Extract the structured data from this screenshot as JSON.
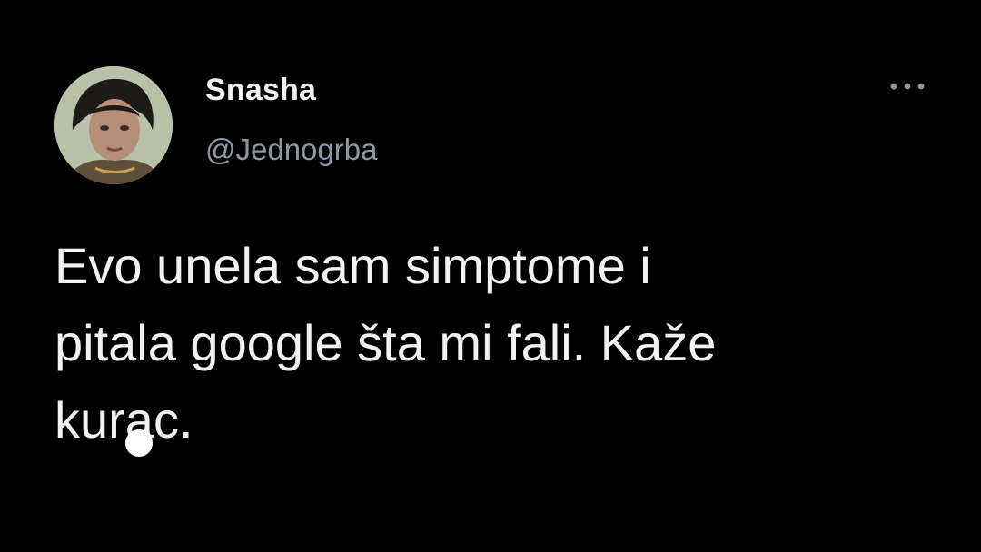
{
  "tweet": {
    "author": {
      "display_name": "Snasha",
      "handle": "@Jednogrba",
      "avatar_icon": "profile-photo"
    },
    "more_icon": "more-horizontal-icon",
    "text": "Evo unela sam simptome i\npitala google šta mi fali. Kaže\nkurac."
  },
  "colors": {
    "background": "#000000",
    "text_primary": "#f1f1f1",
    "text_secondary": "#8b98a5"
  }
}
